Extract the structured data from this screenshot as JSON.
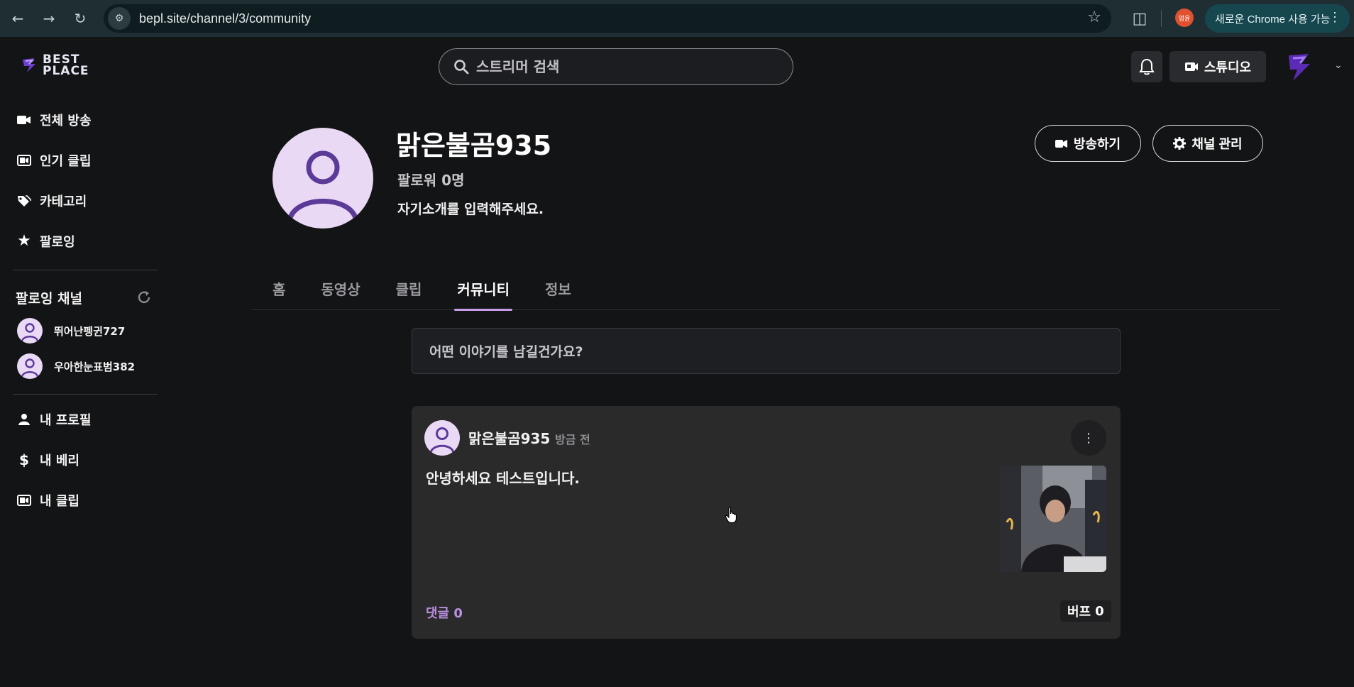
{
  "browser": {
    "url": "bepl.site/channel/3/community",
    "profile_badge": "멍윤",
    "update_label": "새로운 Chrome 사용 가능"
  },
  "header": {
    "logo_line1": "BEST",
    "logo_line2": "PLACE",
    "search_placeholder": "스트리머 검색",
    "studio_label": "스튜디오"
  },
  "sidebar": {
    "main_items": [
      {
        "label": "전체 방송",
        "icon": "video-camera-icon"
      },
      {
        "label": "인기 클립",
        "icon": "clip-icon"
      },
      {
        "label": "카테고리",
        "icon": "tags-icon"
      },
      {
        "label": "팔로잉",
        "icon": "star-icon"
      }
    ],
    "following_title": "팔로잉 채널",
    "following_channels": [
      {
        "name": "뛰어난펭귄727"
      },
      {
        "name": "우아한눈표범382"
      }
    ],
    "bottom_items": [
      {
        "label": "내 프로필",
        "icon": "user-icon"
      },
      {
        "label": "내 베리",
        "icon": "dollar-icon"
      },
      {
        "label": "내 클립",
        "icon": "clip-icon"
      }
    ]
  },
  "channel": {
    "name": "맑은불곰935",
    "followers": "팔로워 0명",
    "intro": "자기소개를 입력해주세요.",
    "broadcast_button": "방송하기",
    "manage_button": "채널 관리"
  },
  "tabs": [
    {
      "label": "홈",
      "active": false
    },
    {
      "label": "동영상",
      "active": false
    },
    {
      "label": "클립",
      "active": false
    },
    {
      "label": "커뮤니티",
      "active": true
    },
    {
      "label": "정보",
      "active": false
    }
  ],
  "community": {
    "write_placeholder": "어떤 이야기를 남길건가요?",
    "posts": [
      {
        "author": "맑은불곰935",
        "time": "방금 전",
        "text": "안녕하세요 테스트입니다.",
        "comments_label": "댓글 0",
        "buff_label": "버프",
        "buff_count": "0"
      }
    ]
  },
  "colors": {
    "accent": "#c79be8",
    "background": "#131416",
    "card": "#2a2a2a",
    "avatar_bg": "#ead9f5",
    "avatar_fg": "#5b3a98"
  }
}
